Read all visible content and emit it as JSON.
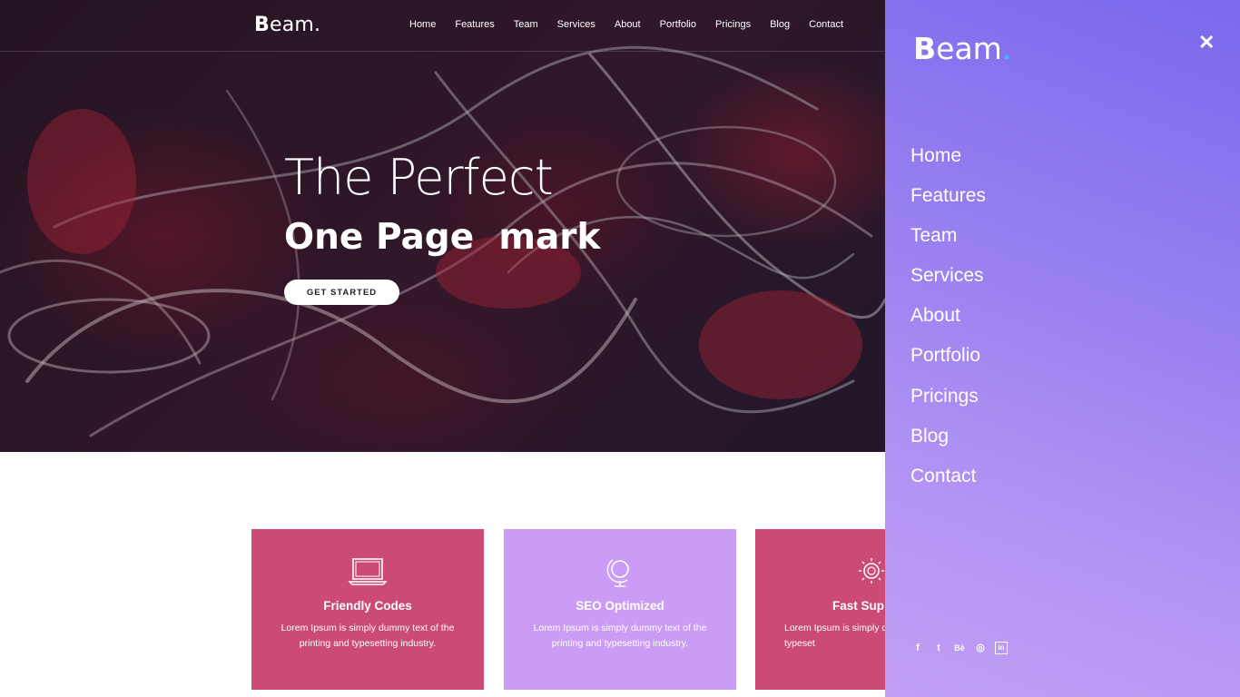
{
  "site": {
    "logo_b": "B",
    "logo_rest": "eam",
    "logo_dot": "."
  },
  "nav": {
    "items": [
      "Home",
      "Features",
      "Team",
      "Services",
      "About",
      "Portfolio",
      "Pricings",
      "Blog",
      "Contact"
    ]
  },
  "hero": {
    "line1": "The Perfect",
    "line2": "One Page  mark",
    "cta": "GET STARTED"
  },
  "features": [
    {
      "icon": "laptop-icon",
      "title": "Friendly Codes",
      "text": "Lorem Ipsum is simply dummy text of the printing and typesetting industry.",
      "color": "#cc4a77"
    },
    {
      "icon": "globe-icon",
      "title": "SEO Optimized",
      "text": "Lorem Ipsum is simply dummy text of the printing and typesetting industry.",
      "color": "#cb9cf6"
    },
    {
      "icon": "support-icon",
      "title": "Fast Sup",
      "text": "Lorem Ipsum is simply d printing and typeset",
      "color": "#cc4a77"
    }
  ],
  "panel": {
    "close": "✕",
    "items": [
      "Home",
      "Features",
      "Team",
      "Services",
      "About",
      "Portfolio",
      "Pricings",
      "Blog",
      "Contact"
    ],
    "social": [
      {
        "icon": "facebook-icon",
        "glyph": "f"
      },
      {
        "icon": "twitter-icon",
        "glyph": "t"
      },
      {
        "icon": "behance-icon",
        "glyph": "Bē"
      },
      {
        "icon": "dribbble-icon",
        "glyph": "◎"
      },
      {
        "icon": "linkedin-icon",
        "glyph": "in"
      }
    ]
  },
  "colors": {
    "panel_top": "#7a69ee",
    "panel_bottom": "#c29ef5",
    "card_pink": "#cc4a77",
    "card_lilac": "#cb9cf6",
    "logo_dot": "#39c3f5"
  }
}
